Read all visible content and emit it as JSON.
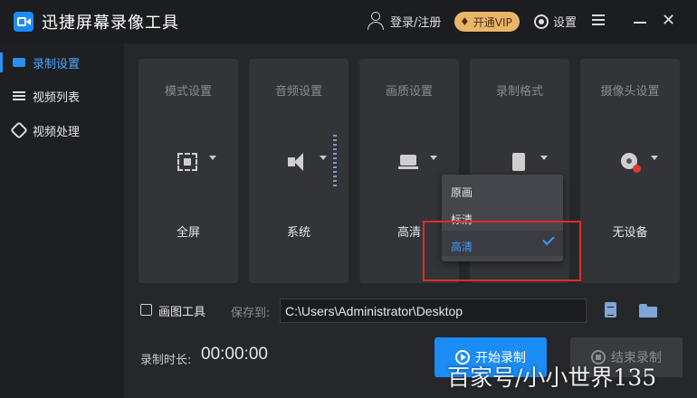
{
  "app": {
    "title": "迅捷屏幕录像工具"
  },
  "header": {
    "login": "登录/注册",
    "vip": "开通VIP",
    "settings": "设置"
  },
  "sidebar": {
    "items": [
      {
        "label": "录制设置",
        "icon": "record-icon"
      },
      {
        "label": "视频列表",
        "icon": "list-icon"
      },
      {
        "label": "视频处理",
        "icon": "process-icon"
      }
    ]
  },
  "cards": [
    {
      "title": "模式设置",
      "value": "全屏",
      "icon": "fullscreen-icon"
    },
    {
      "title": "音频设置",
      "value": "系统",
      "icon": "speaker-icon"
    },
    {
      "title": "画质设置",
      "value": "高清",
      "icon": "laptop-icon"
    },
    {
      "title": "录制格式",
      "value": "",
      "icon": "file-icon"
    },
    {
      "title": "摄像头设置",
      "value": "无设备",
      "icon": "camera-icon"
    }
  ],
  "quality_dropdown": {
    "options": [
      "原画",
      "标清",
      "高清"
    ],
    "selected": "高清"
  },
  "controls": {
    "draw_tool": "画图工具",
    "save_to": "保存到:",
    "path": "C:\\Users\\Administrator\\Desktop",
    "duration_label": "录制时长:",
    "duration": "00:00:00",
    "start": "开始录制",
    "stop": "结束录制"
  },
  "watermark": "百家号/小小世界135",
  "colors": {
    "accent": "#1b8cf5",
    "vip": "#e9b56b",
    "highlight": "#e02b2b"
  }
}
